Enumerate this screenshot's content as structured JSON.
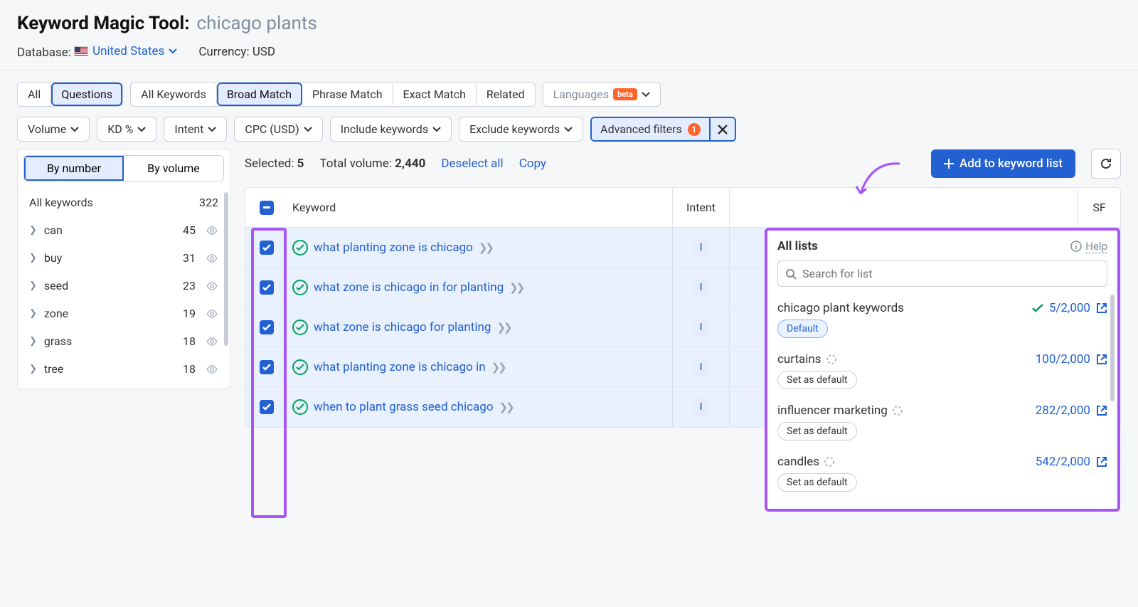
{
  "header": {
    "tool": "Keyword Magic Tool:",
    "keyword": "chicago plants",
    "db_label": "Database:",
    "db_value": "United States",
    "currency_label": "Currency:",
    "currency_value": "USD"
  },
  "tabs": {
    "group1": [
      "All",
      "Questions"
    ],
    "group2": [
      "All Keywords",
      "Broad Match",
      "Phrase Match",
      "Exact Match",
      "Related"
    ],
    "languages": "Languages",
    "beta": "beta"
  },
  "filters": {
    "volume": "Volume",
    "kd": "KD %",
    "intent": "Intent",
    "cpc": "CPC (USD)",
    "include": "Include keywords",
    "exclude": "Exclude keywords",
    "advanced": "Advanced filters",
    "adv_count": "1"
  },
  "sidebar": {
    "by_number": "By number",
    "by_volume": "By volume",
    "all_label": "All keywords",
    "all_count": "322",
    "items": [
      {
        "label": "can",
        "count": "45"
      },
      {
        "label": "buy",
        "count": "31"
      },
      {
        "label": "seed",
        "count": "23"
      },
      {
        "label": "zone",
        "count": "19"
      },
      {
        "label": "grass",
        "count": "18"
      },
      {
        "label": "tree",
        "count": "18"
      }
    ]
  },
  "actions": {
    "selected_label": "Selected: ",
    "selected": "5",
    "total_label": "Total volume: ",
    "total": "2,440",
    "deselect": "Deselect all",
    "copy": "Copy",
    "add": "Add to keyword list"
  },
  "table": {
    "th_keyword": "Keyword",
    "th_intent": "Intent",
    "th_sf": "SF",
    "rows": [
      {
        "kw": "what planting zone is chicago",
        "intent": "I"
      },
      {
        "kw": "what zone is chicago in for planting",
        "intent": "I"
      },
      {
        "kw": "what zone is chicago for planting",
        "intent": "I"
      },
      {
        "kw": "what planting zone is chicago in",
        "intent": "I"
      },
      {
        "kw": "when to plant grass seed chicago",
        "intent": "I"
      }
    ]
  },
  "popup": {
    "title": "All lists",
    "help": "Help",
    "search_ph": "Search for list",
    "lists": [
      {
        "name": "chicago plant keywords",
        "count": "5/2,000",
        "default": true,
        "checked": true
      },
      {
        "name": "curtains",
        "count": "100/2,000",
        "default": false
      },
      {
        "name": "influencer marketing",
        "count": "282/2,000",
        "default": false
      },
      {
        "name": "candles",
        "count": "542/2,000",
        "default": false
      }
    ],
    "default_tag": "Default",
    "set_default": "Set as default"
  }
}
